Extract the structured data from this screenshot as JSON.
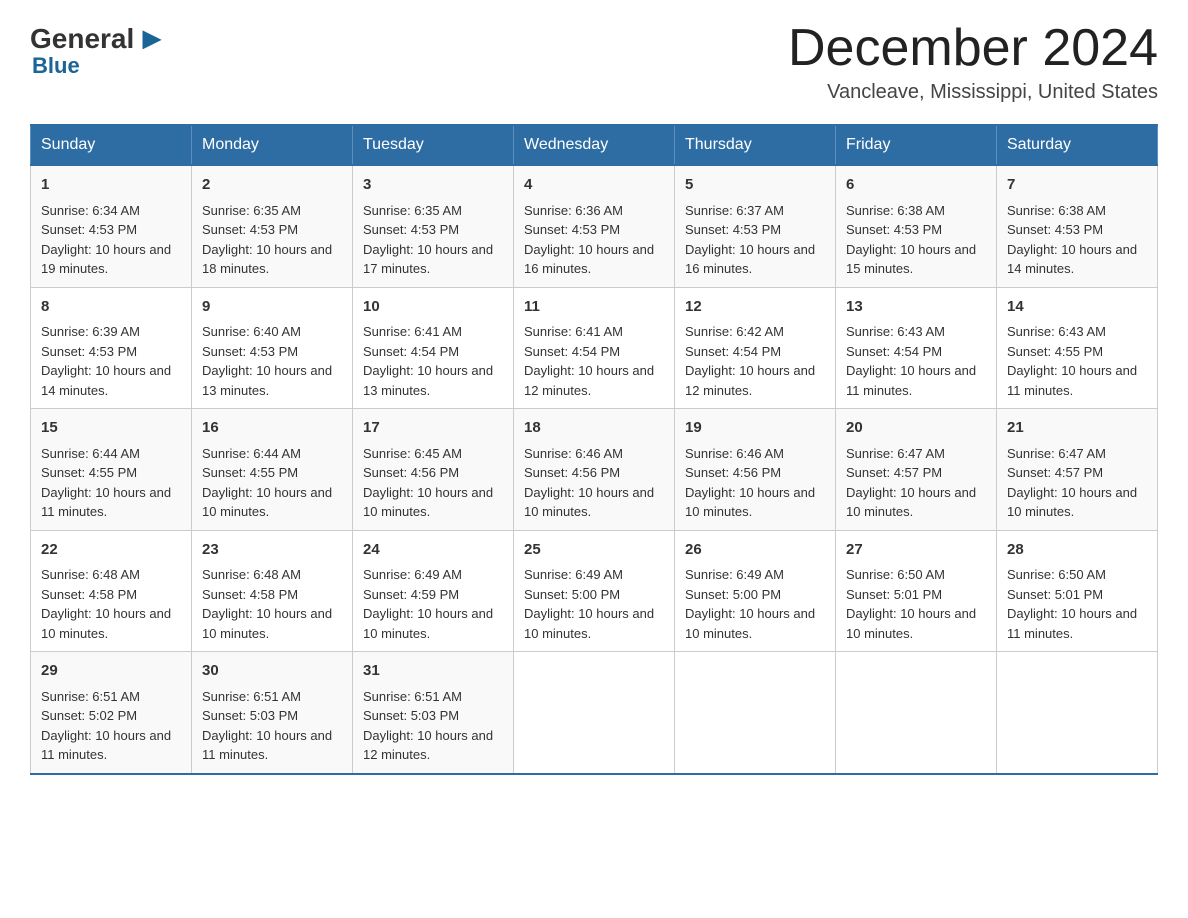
{
  "header": {
    "logo_general": "General",
    "logo_blue": "Blue",
    "title": "December 2024",
    "subtitle": "Vancleave, Mississippi, United States"
  },
  "weekdays": [
    "Sunday",
    "Monday",
    "Tuesday",
    "Wednesday",
    "Thursday",
    "Friday",
    "Saturday"
  ],
  "weeks": [
    [
      {
        "day": "1",
        "sunrise": "6:34 AM",
        "sunset": "4:53 PM",
        "daylight": "10 hours and 19 minutes."
      },
      {
        "day": "2",
        "sunrise": "6:35 AM",
        "sunset": "4:53 PM",
        "daylight": "10 hours and 18 minutes."
      },
      {
        "day": "3",
        "sunrise": "6:35 AM",
        "sunset": "4:53 PM",
        "daylight": "10 hours and 17 minutes."
      },
      {
        "day": "4",
        "sunrise": "6:36 AM",
        "sunset": "4:53 PM",
        "daylight": "10 hours and 16 minutes."
      },
      {
        "day": "5",
        "sunrise": "6:37 AM",
        "sunset": "4:53 PM",
        "daylight": "10 hours and 16 minutes."
      },
      {
        "day": "6",
        "sunrise": "6:38 AM",
        "sunset": "4:53 PM",
        "daylight": "10 hours and 15 minutes."
      },
      {
        "day": "7",
        "sunrise": "6:38 AM",
        "sunset": "4:53 PM",
        "daylight": "10 hours and 14 minutes."
      }
    ],
    [
      {
        "day": "8",
        "sunrise": "6:39 AM",
        "sunset": "4:53 PM",
        "daylight": "10 hours and 14 minutes."
      },
      {
        "day": "9",
        "sunrise": "6:40 AM",
        "sunset": "4:53 PM",
        "daylight": "10 hours and 13 minutes."
      },
      {
        "day": "10",
        "sunrise": "6:41 AM",
        "sunset": "4:54 PM",
        "daylight": "10 hours and 13 minutes."
      },
      {
        "day": "11",
        "sunrise": "6:41 AM",
        "sunset": "4:54 PM",
        "daylight": "10 hours and 12 minutes."
      },
      {
        "day": "12",
        "sunrise": "6:42 AM",
        "sunset": "4:54 PM",
        "daylight": "10 hours and 12 minutes."
      },
      {
        "day": "13",
        "sunrise": "6:43 AM",
        "sunset": "4:54 PM",
        "daylight": "10 hours and 11 minutes."
      },
      {
        "day": "14",
        "sunrise": "6:43 AM",
        "sunset": "4:55 PM",
        "daylight": "10 hours and 11 minutes."
      }
    ],
    [
      {
        "day": "15",
        "sunrise": "6:44 AM",
        "sunset": "4:55 PM",
        "daylight": "10 hours and 11 minutes."
      },
      {
        "day": "16",
        "sunrise": "6:44 AM",
        "sunset": "4:55 PM",
        "daylight": "10 hours and 10 minutes."
      },
      {
        "day": "17",
        "sunrise": "6:45 AM",
        "sunset": "4:56 PM",
        "daylight": "10 hours and 10 minutes."
      },
      {
        "day": "18",
        "sunrise": "6:46 AM",
        "sunset": "4:56 PM",
        "daylight": "10 hours and 10 minutes."
      },
      {
        "day": "19",
        "sunrise": "6:46 AM",
        "sunset": "4:56 PM",
        "daylight": "10 hours and 10 minutes."
      },
      {
        "day": "20",
        "sunrise": "6:47 AM",
        "sunset": "4:57 PM",
        "daylight": "10 hours and 10 minutes."
      },
      {
        "day": "21",
        "sunrise": "6:47 AM",
        "sunset": "4:57 PM",
        "daylight": "10 hours and 10 minutes."
      }
    ],
    [
      {
        "day": "22",
        "sunrise": "6:48 AM",
        "sunset": "4:58 PM",
        "daylight": "10 hours and 10 minutes."
      },
      {
        "day": "23",
        "sunrise": "6:48 AM",
        "sunset": "4:58 PM",
        "daylight": "10 hours and 10 minutes."
      },
      {
        "day": "24",
        "sunrise": "6:49 AM",
        "sunset": "4:59 PM",
        "daylight": "10 hours and 10 minutes."
      },
      {
        "day": "25",
        "sunrise": "6:49 AM",
        "sunset": "5:00 PM",
        "daylight": "10 hours and 10 minutes."
      },
      {
        "day": "26",
        "sunrise": "6:49 AM",
        "sunset": "5:00 PM",
        "daylight": "10 hours and 10 minutes."
      },
      {
        "day": "27",
        "sunrise": "6:50 AM",
        "sunset": "5:01 PM",
        "daylight": "10 hours and 10 minutes."
      },
      {
        "day": "28",
        "sunrise": "6:50 AM",
        "sunset": "5:01 PM",
        "daylight": "10 hours and 11 minutes."
      }
    ],
    [
      {
        "day": "29",
        "sunrise": "6:51 AM",
        "sunset": "5:02 PM",
        "daylight": "10 hours and 11 minutes."
      },
      {
        "day": "30",
        "sunrise": "6:51 AM",
        "sunset": "5:03 PM",
        "daylight": "10 hours and 11 minutes."
      },
      {
        "day": "31",
        "sunrise": "6:51 AM",
        "sunset": "5:03 PM",
        "daylight": "10 hours and 12 minutes."
      },
      null,
      null,
      null,
      null
    ]
  ],
  "labels": {
    "sunrise": "Sunrise:",
    "sunset": "Sunset:",
    "daylight": "Daylight:"
  }
}
